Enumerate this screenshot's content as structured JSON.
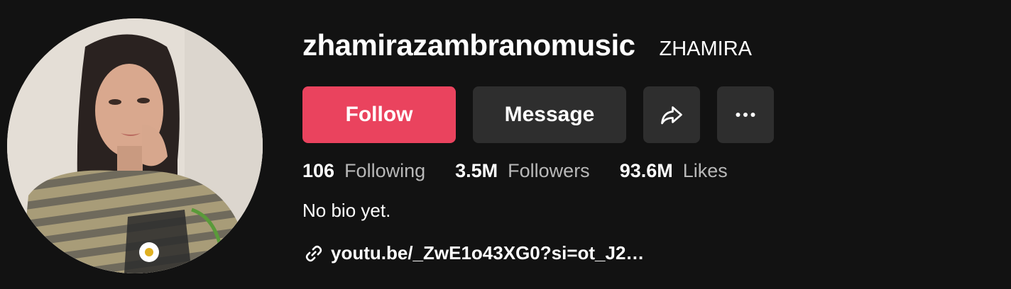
{
  "profile": {
    "username": "zhamirazambranomusic",
    "nickname": "ZHAMIRA",
    "avatar_icon": "profile-photo"
  },
  "actions": {
    "follow_label": "Follow",
    "message_label": "Message",
    "share_icon": "share-arrow-icon",
    "more_icon": "ellipsis-icon"
  },
  "stats": [
    {
      "value": "106",
      "label": "Following"
    },
    {
      "value": "3.5M",
      "label": "Followers"
    },
    {
      "value": "93.6M",
      "label": "Likes"
    }
  ],
  "bio": "No bio yet.",
  "link": {
    "icon": "link-icon",
    "text": "youtu.be/_ZwE1o43XG0?si=ot_J2…"
  },
  "colors": {
    "background": "#121212",
    "follow_button": "#ea435e",
    "secondary_button": "#2e2e2e",
    "muted_text": "#b8b8b8"
  }
}
